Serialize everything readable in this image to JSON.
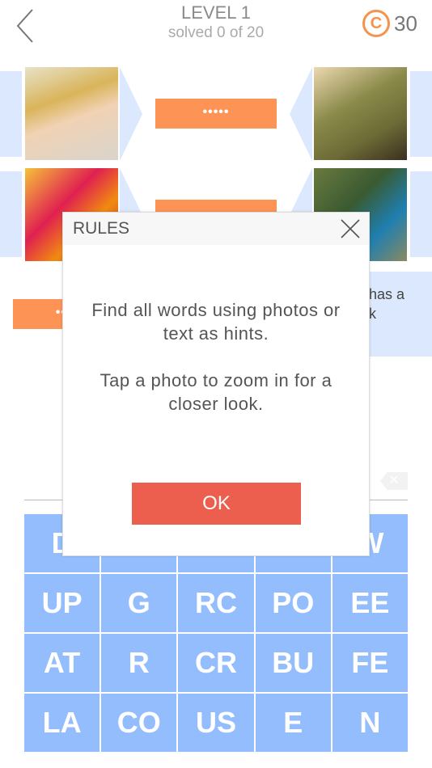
{
  "header": {
    "title": "LEVEL 1",
    "subtitle": "solved 0 of 20",
    "coins": "30",
    "coin_symbol": "C"
  },
  "puzzles": [
    {
      "mask": "•••••"
    },
    {
      "mask": ""
    },
    {
      "mask": "••"
    }
  ],
  "hint_text": "has a\nk",
  "delete_label": "✕",
  "keyboard": [
    "D",
    "",
    "",
    "",
    "W",
    "UP",
    "G",
    "RC",
    "PO",
    "EE",
    "AT",
    "R",
    "CR",
    "BU",
    "FE",
    "LA",
    "CO",
    "US",
    "E",
    "N"
  ],
  "dialog": {
    "title": "RULES",
    "line1": "Find all words using photos or text as hints.",
    "line2": "Tap a photo to zoom in for a closer look.",
    "ok": "OK"
  },
  "colors": {
    "accent": "#fd9455",
    "key": "#93bdfc",
    "ok": "#ec5f4f",
    "hint": "#dbe8fd"
  }
}
